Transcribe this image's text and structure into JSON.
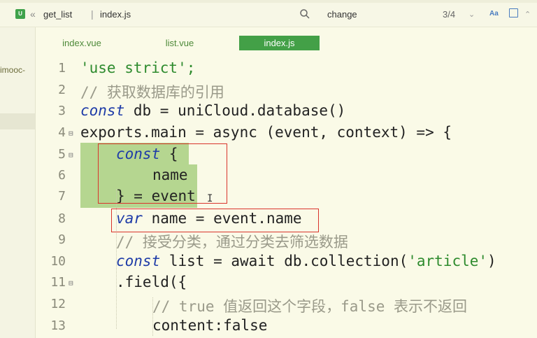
{
  "breadcrumb": {
    "separator_icon": "«",
    "project": "get_list",
    "file": "index.js"
  },
  "search": {
    "query": "change",
    "match_count": "3/4",
    "case_label": "Aa"
  },
  "sidebar": {
    "project_label": "imooc-"
  },
  "tabs": [
    {
      "label": "index.vue"
    },
    {
      "label": "list.vue"
    },
    {
      "label": "index.js",
      "active": true
    }
  ],
  "lines": [
    {
      "num": "1",
      "text": "'use strict';"
    },
    {
      "num": "2",
      "text": "// 获取数据库的引用"
    },
    {
      "num": "3",
      "parts": [
        "const",
        " db = uniCloud.database()"
      ]
    },
    {
      "num": "4",
      "text": "exports.main = async (event, context) => {"
    },
    {
      "num": "5",
      "parts": [
        "const",
        " {"
      ]
    },
    {
      "num": "6",
      "text": "name"
    },
    {
      "num": "7",
      "text": "} = event"
    },
    {
      "num": "8",
      "parts": [
        "var",
        " name = event.name"
      ]
    },
    {
      "num": "9",
      "text": "// 接受分类，通过分类去筛选数据"
    },
    {
      "num": "10",
      "parts": [
        "const",
        " list = await db.collection(",
        "'article'",
        ")"
      ]
    },
    {
      "num": "11",
      "text": ".field({"
    },
    {
      "num": "12",
      "text": "// true 值返回这个字段，false 表示不返回"
    },
    {
      "num": "13",
      "text": "content:false"
    }
  ],
  "colors": {
    "accent": "#43a047",
    "keyword": "#1f3ca8",
    "string": "#2e8b2e",
    "comment": "#9a9a8a",
    "highlight": "#b5d690",
    "annotation": "#d9342c"
  }
}
